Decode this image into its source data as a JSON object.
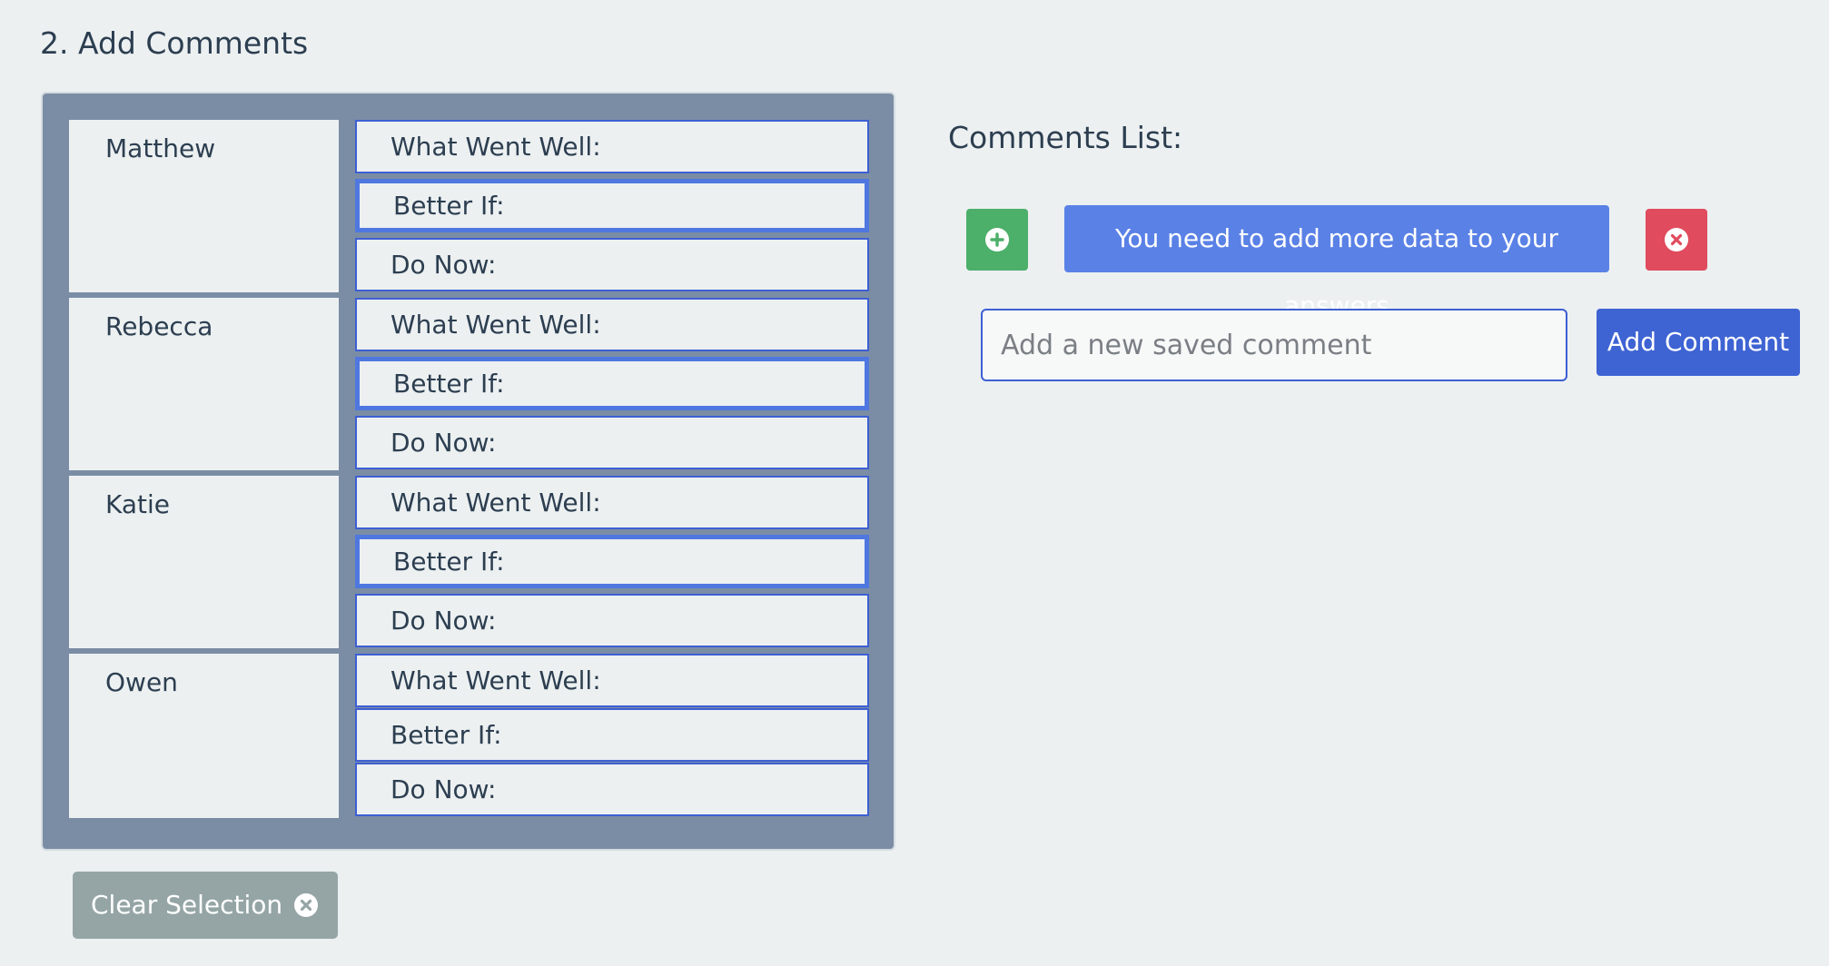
{
  "section": {
    "title": "2. Add Comments"
  },
  "students": [
    {
      "name": "Matthew",
      "fields": [
        {
          "label": "What Went Well:",
          "selected": false
        },
        {
          "label": "Better If:",
          "selected": true
        },
        {
          "label": "Do Now:",
          "selected": false
        }
      ]
    },
    {
      "name": "Rebecca",
      "fields": [
        {
          "label": "What Went Well:",
          "selected": false
        },
        {
          "label": "Better If:",
          "selected": true
        },
        {
          "label": "Do Now:",
          "selected": false
        }
      ]
    },
    {
      "name": "Katie",
      "fields": [
        {
          "label": "What Went Well:",
          "selected": false
        },
        {
          "label": "Better If:",
          "selected": true
        },
        {
          "label": "Do Now:",
          "selected": false
        }
      ]
    },
    {
      "name": "Owen",
      "fields": [
        {
          "label": "What Went Well:",
          "selected": false
        },
        {
          "label": "Better If:",
          "selected": false
        },
        {
          "label": "Do Now:",
          "selected": false
        }
      ]
    }
  ],
  "clear_selection": {
    "label": "Clear Selection",
    "icon": "close-circle-icon"
  },
  "comments": {
    "title": "Comments List:",
    "items": [
      {
        "text": "You need to add more data to your answers",
        "add_icon": "plus-circle-icon",
        "remove_icon": "close-circle-icon"
      }
    ],
    "input_placeholder": "Add a new saved comment",
    "input_value": "",
    "add_button_label": "Add Comment"
  },
  "colors": {
    "background": "#ecf0f1",
    "panel": "#7b8da4",
    "field_border": "#3d5fd4",
    "comment_chip": "#5a81e6",
    "add_green": "#4caf6a",
    "remove_red": "#e04b5e",
    "clear_gray": "#95a5a6",
    "primary_button": "#3e63d3"
  }
}
